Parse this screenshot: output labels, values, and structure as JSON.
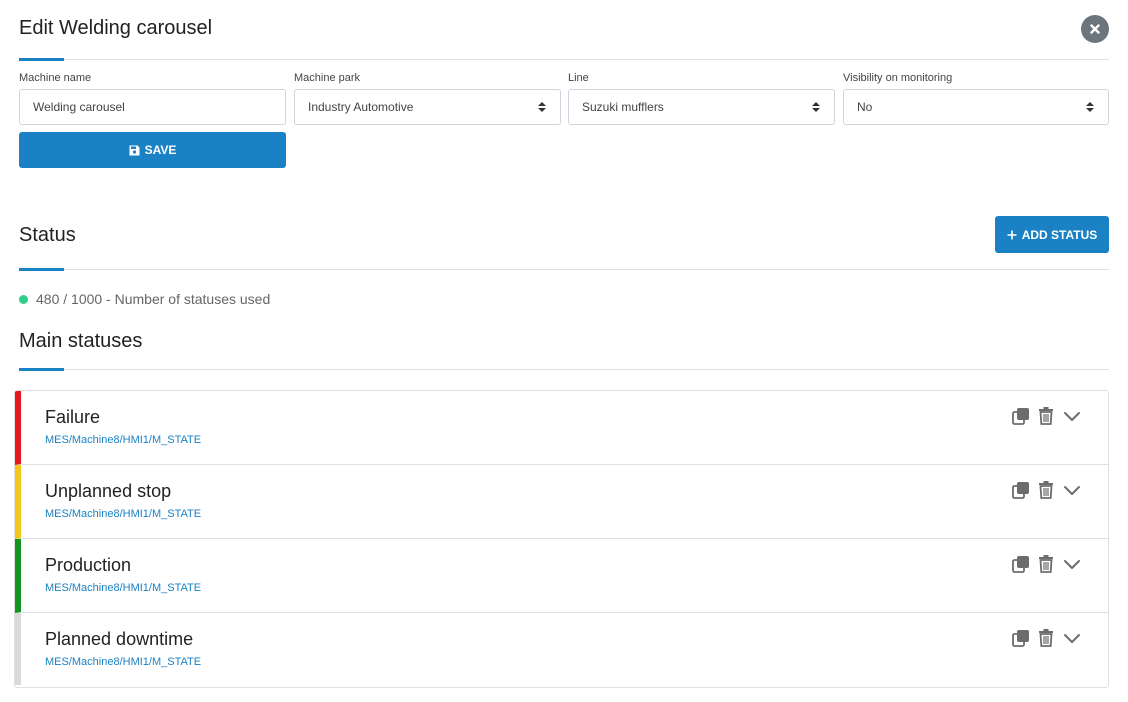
{
  "header": {
    "title": "Edit Welding carousel"
  },
  "form": {
    "machine_name": {
      "label": "Machine name",
      "value": "Welding carousel"
    },
    "machine_park": {
      "label": "Machine park",
      "value": "Industry Automotive"
    },
    "line": {
      "label": "Line",
      "value": "Suzuki mufflers"
    },
    "visibility": {
      "label": "Visibility on monitoring",
      "value": "No"
    },
    "save_label": "SAVE"
  },
  "status_section": {
    "title": "Status",
    "add_label": "ADD STATUS",
    "usage_text": "480 / 1000 - Number of statuses used",
    "usage_color": "#2fcc8b"
  },
  "main_statuses": {
    "title": "Main statuses",
    "items": [
      {
        "name": "Failure",
        "path": "MES/Machine8/HMI1/M_STATE",
        "color": "#e3191b"
      },
      {
        "name": "Unplanned stop",
        "path": "MES/Machine8/HMI1/M_STATE",
        "color": "#f5c518"
      },
      {
        "name": "Production",
        "path": "MES/Machine8/HMI1/M_STATE",
        "color": "#14961e"
      },
      {
        "name": "Planned downtime",
        "path": "MES/Machine8/HMI1/M_STATE",
        "color": "#d9d9d9"
      }
    ]
  },
  "colors": {
    "accent": "#1a82c4",
    "icon_gray": "#6c6c6c"
  },
  "icons": {
    "close": "close-icon",
    "save": "floppy-disk-icon",
    "add": "plus-icon",
    "duplicate": "copy-icon",
    "delete": "trash-icon",
    "expand": "chevron-down-icon",
    "select": "sort-icon"
  }
}
